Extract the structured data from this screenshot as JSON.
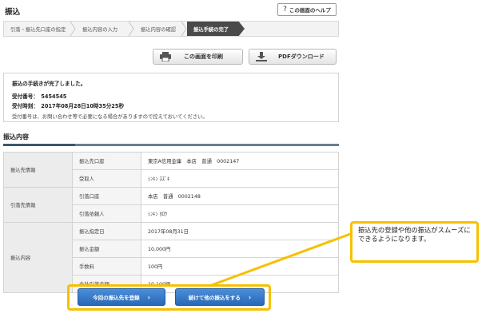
{
  "header": {
    "title": "振込",
    "help_label": "この画面のヘルプ",
    "help_icon": "?"
  },
  "steps": [
    {
      "label": "引落・振込先口座の指定"
    },
    {
      "label": "振込内容の入力"
    },
    {
      "label": "振込内容の確認"
    },
    {
      "label": "振込手続の完了",
      "active": true
    }
  ],
  "toolbar": {
    "print_label": "この画面を印刷",
    "pdf_label": "PDFダウンロード"
  },
  "completion": {
    "message": "振込の手続きが完了しました。",
    "receipt_number": "受付番号：　5454545",
    "receipt_time": "受付時刻：　2017年08月28日10時35分25秒",
    "note": "受付番号は、お問い合わせ等で必要になる場合がありますので控えておいてください。"
  },
  "section": {
    "title": "振込内容"
  },
  "details": {
    "groups": [
      {
        "name": "振込先情報",
        "rows": [
          {
            "label": "振込先口座",
            "value": "東京A信用金庫　本店　普通　0002147"
          },
          {
            "label": "受取人",
            "value": "ｼﾝｷﾝ ｽｽﾞｷ"
          }
        ]
      },
      {
        "name": "引落先情報",
        "rows": [
          {
            "label": "引落口座",
            "value": "本店　普通　0002148"
          },
          {
            "label": "引落依頼人",
            "value": "ｼﾝｷﾝ ﾀﾛｳ"
          }
        ]
      },
      {
        "name": "振込内容",
        "rows": [
          {
            "label": "振込指定日",
            "value": "2017年08月31日"
          },
          {
            "label": "振込金額",
            "value": "10,000円"
          },
          {
            "label": "手数料",
            "value": "100円"
          },
          {
            "label": "合計引落金額",
            "value": "10,100円"
          }
        ]
      }
    ]
  },
  "actions": {
    "register_label": "今回の振込先を登録",
    "continue_label": "続けて他の振込をする",
    "arrow": "›"
  },
  "callout": {
    "text": "振込先の登録や他の振込がスムーズにできるようになります。"
  },
  "colors": {
    "highlight": "#f6c000",
    "primary_button": "#2f74c4",
    "active_step": "#4a4a4a"
  }
}
